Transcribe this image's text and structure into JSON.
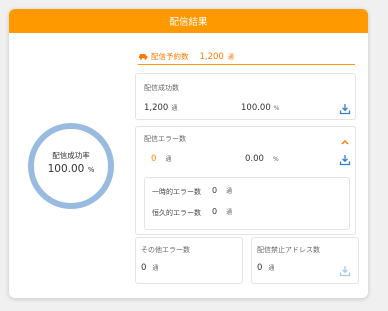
{
  "header": {
    "title": "配信結果"
  },
  "rate": {
    "label": "配信成功率",
    "value": "100.00",
    "unit": "%"
  },
  "planned": {
    "label": "配信予約数",
    "value": "1,200",
    "unit": "通"
  },
  "success": {
    "title": "配信成功数",
    "count": "1,200",
    "count_unit": "通",
    "percent": "100.00",
    "percent_unit": "%"
  },
  "error": {
    "title": "配信エラー数",
    "count": "0",
    "count_unit": "通",
    "percent": "0.00",
    "percent_unit": "%",
    "temporary": {
      "label": "一時的エラー数",
      "count": "0",
      "unit": "通"
    },
    "permanent": {
      "label": "恒久的エラー数",
      "count": "0",
      "unit": "通"
    }
  },
  "other_error": {
    "title": "その他エラー数",
    "count": "0",
    "unit": "通"
  },
  "blocked": {
    "title": "配信禁止アドレス数",
    "count": "0",
    "unit": "通"
  },
  "colors": {
    "accent": "#ff9900",
    "blue": "#2f7fc8",
    "ring": "#99bbe0"
  },
  "icons": {
    "download": "download-icon",
    "chevron": "chevron-up-icon",
    "car": "car-icon"
  }
}
